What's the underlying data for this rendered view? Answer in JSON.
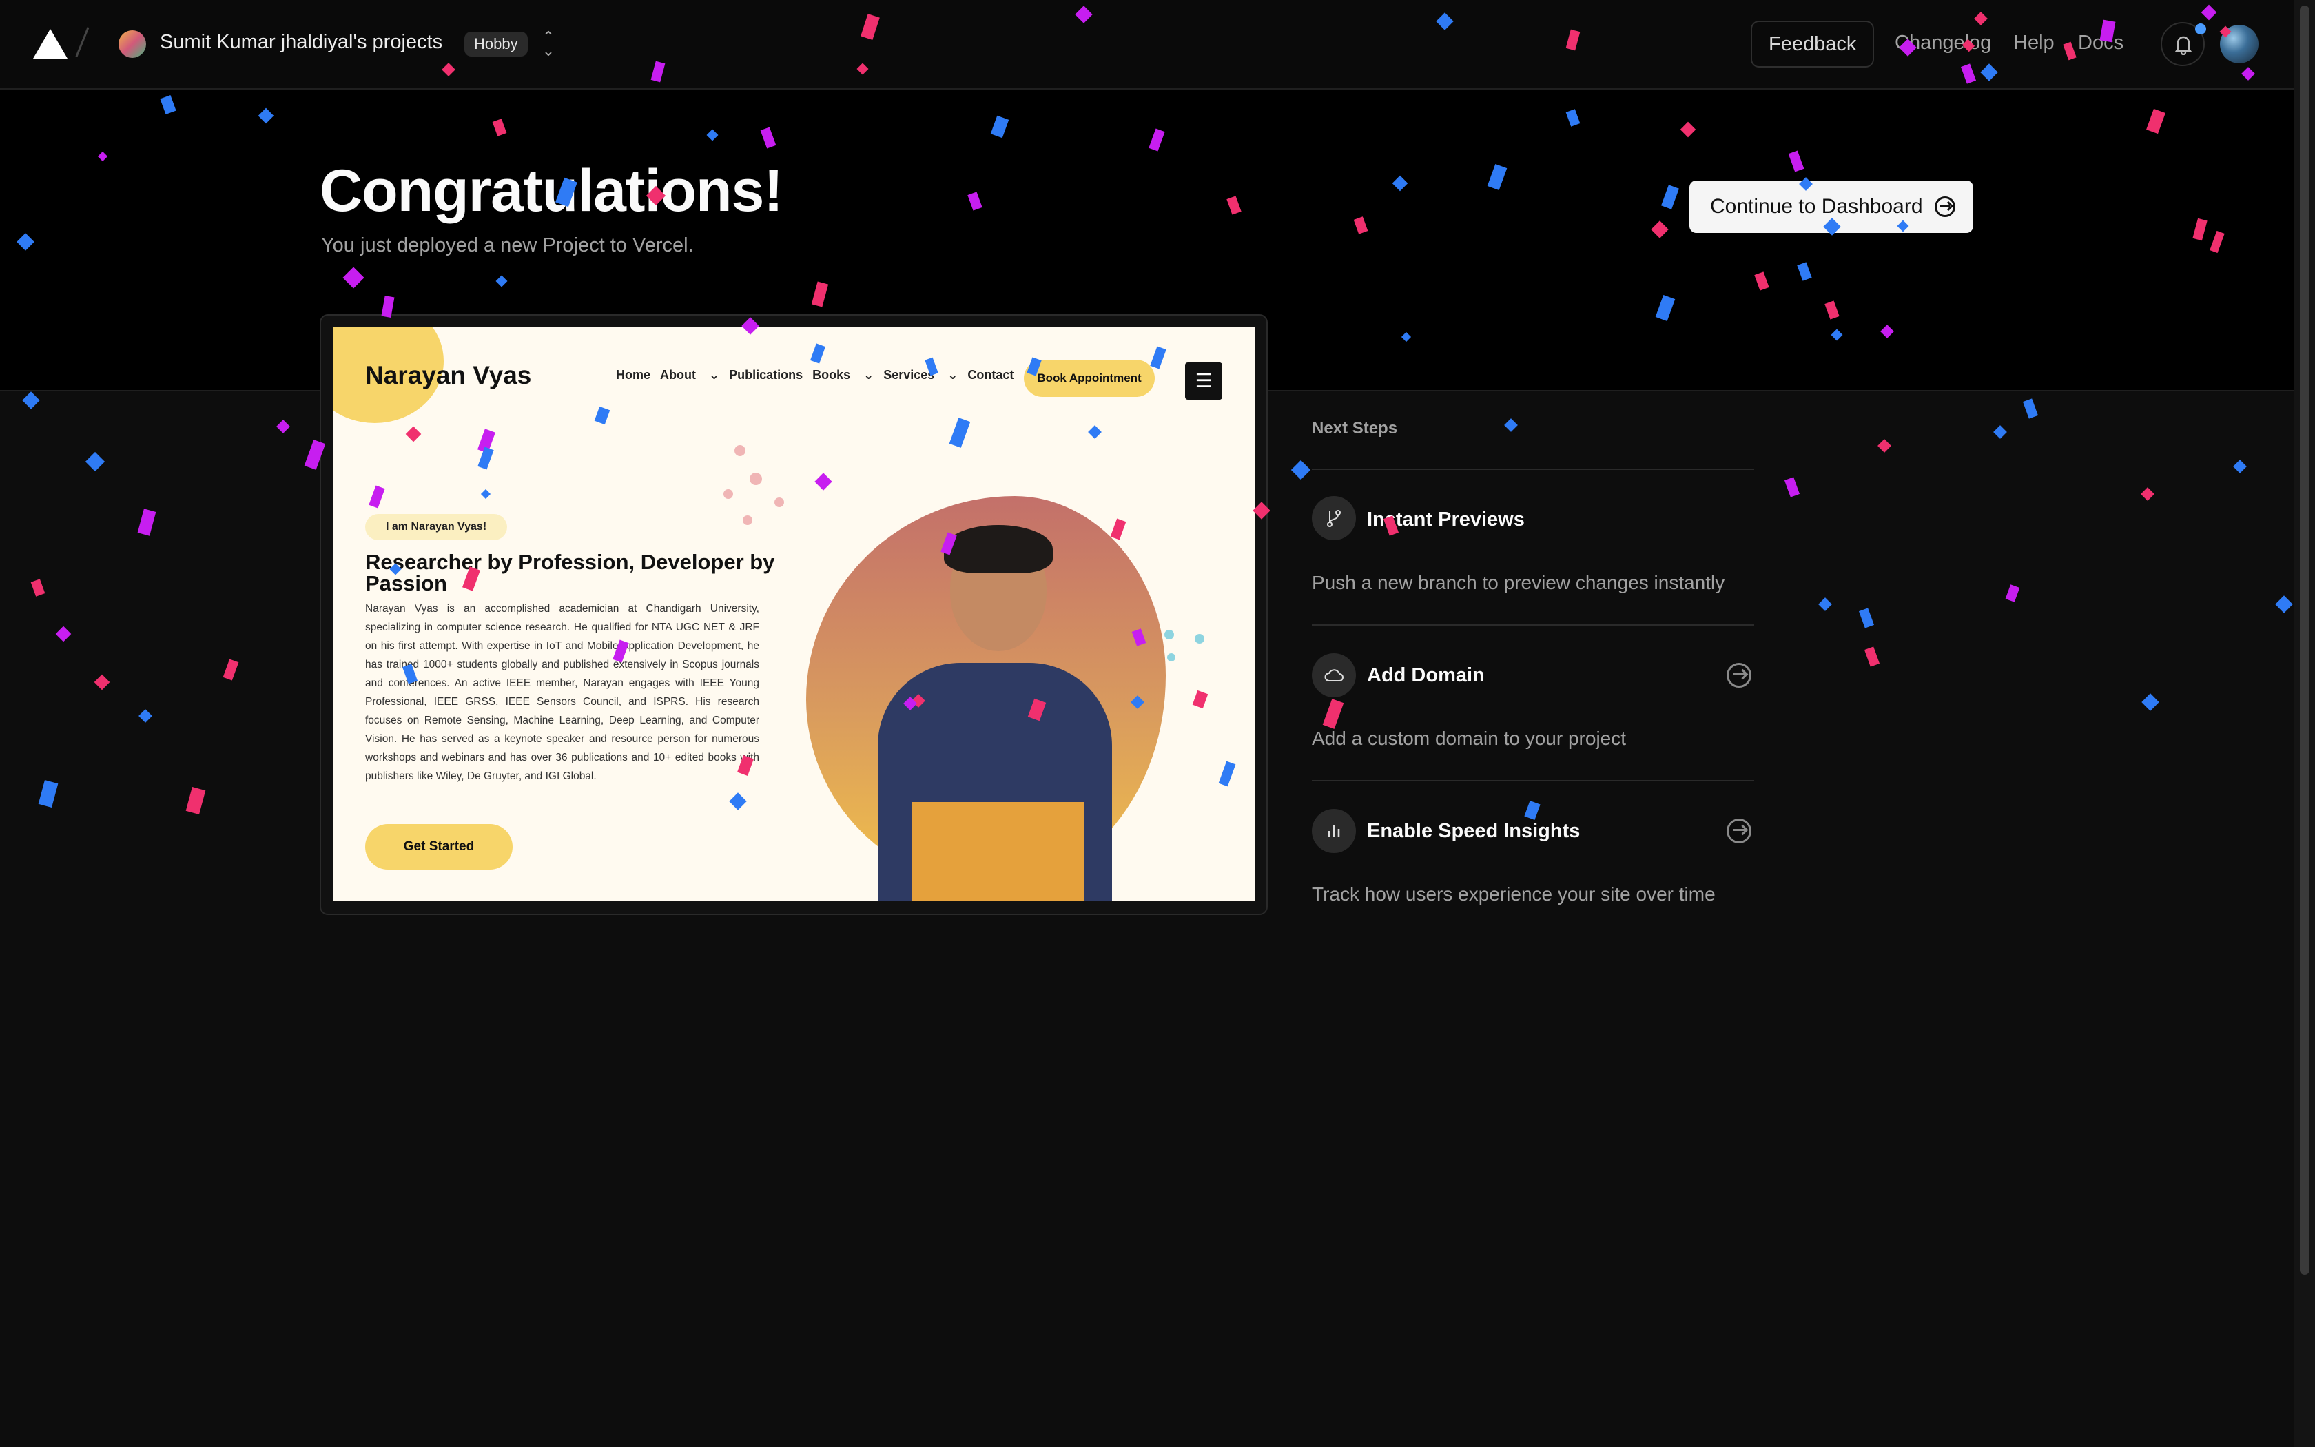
{
  "header": {
    "team_name": "Sumit Kumar jhaldiyal's projects",
    "plan_badge": "Hobby",
    "feedback_label": "Feedback",
    "links": [
      "Changelog",
      "Help",
      "Docs"
    ]
  },
  "hero": {
    "title": "Congratulations!",
    "subtitle": "You just deployed a new Project to Vercel.",
    "continue_label": "Continue to Dashboard"
  },
  "preview": {
    "brand": "Narayan Vyas",
    "nav": [
      "Home",
      "About",
      "Publications",
      "Books",
      "Services",
      "Contact"
    ],
    "book_label": "Book Appointment",
    "pill": "I am Narayan Vyas!",
    "heading": "Researcher by Profession, Developer by Passion",
    "body": "Narayan Vyas is an accomplished academician at Chandigarh University, specializing in computer science research. He qualified for NTA UGC NET & JRF on his first attempt. With expertise in IoT and Mobile Application Development, he has trained 1000+ students globally and published extensively in Scopus journals and conferences. An active IEEE member, Narayan engages with IEEE Young Professional, IEEE GRSS, IEEE Sensors Council, and ISPRS. His research focuses on Remote Sensing, Machine Learning, Deep Learning, and Computer Vision. He has served as a keynote speaker and resource person for numerous workshops and webinars and has over 36 publications and 10+ edited books with publishers like Wiley, De Gruyter, and IGI Global.",
    "cta": "Get Started"
  },
  "next_steps": {
    "title": "Next Steps",
    "items": [
      {
        "title": "Instant Previews",
        "desc": "Push a new branch to preview changes instantly",
        "icon": "git-branch-icon"
      },
      {
        "title": "Add Domain",
        "desc": "Add a custom domain to your project",
        "icon": "cloud-icon"
      },
      {
        "title": "Enable Speed Insights",
        "desc": "Track how users experience your site over time",
        "icon": "bar-chart-icon"
      }
    ]
  },
  "colors": {
    "confetti_pink": "#f0306e",
    "confetti_blue": "#2f7bf5",
    "confetti_purple": "#c71ef0",
    "site_accent": "#f7d56a"
  }
}
